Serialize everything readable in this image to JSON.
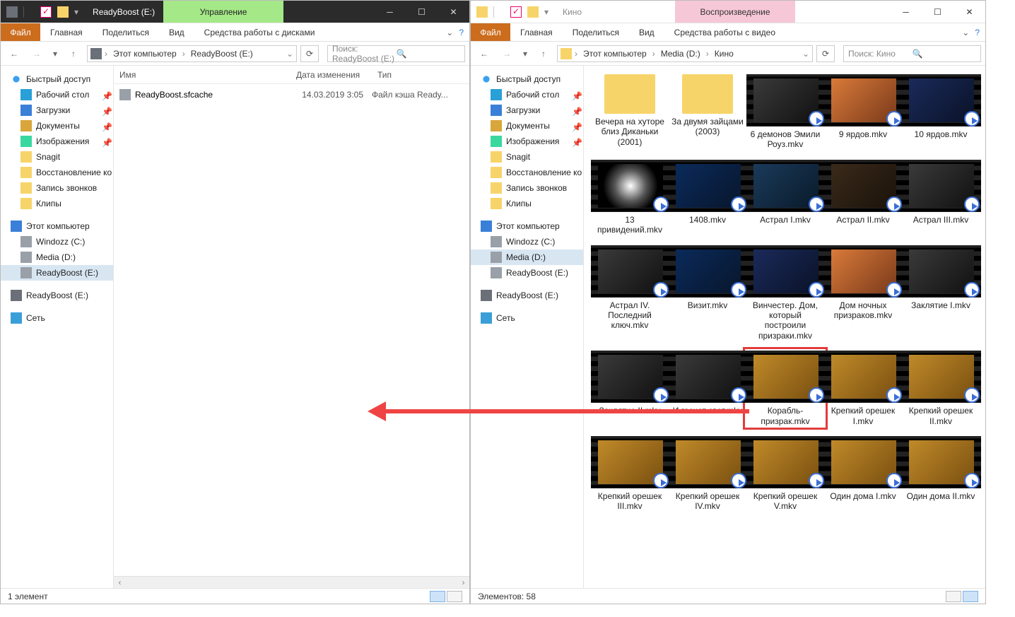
{
  "left": {
    "title": "ReadyBoost (E:)",
    "context_tab": "Управление",
    "file_menu": "Файл",
    "tabs": [
      "Главная",
      "Поделиться",
      "Вид"
    ],
    "context_ribbon": "Средства работы с дисками",
    "breadcrumbs": [
      "Этот компьютер",
      "ReadyBoost (E:)"
    ],
    "search_placeholder": "Поиск: ReadyBoost (E:)",
    "columns": {
      "name": "Имя",
      "date": "Дата изменения",
      "type": "Тип"
    },
    "file": {
      "name": "ReadyBoost.sfcache",
      "date": "14.03.2019 3:05",
      "type": "Файл кэша Ready..."
    },
    "status": "1 элемент"
  },
  "right": {
    "title": "Кино",
    "context_tab": "Воспроизведение",
    "file_menu": "Файл",
    "tabs": [
      "Главная",
      "Поделиться",
      "Вид"
    ],
    "context_ribbon": "Средства работы с видео",
    "breadcrumbs": [
      "Этот компьютер",
      "Media (D:)",
      "Кино"
    ],
    "search_placeholder": "Поиск: Кино",
    "status": "Элементов: 58",
    "items": [
      {
        "label": "Вечера на хуторе близ Диканьки (2001)",
        "folder": true
      },
      {
        "label": "За двумя зайцами (2003)",
        "folder": true
      },
      {
        "label": "6 демонов Эмили Роуз.mkv",
        "c": "c3"
      },
      {
        "label": "9 ярдов.mkv",
        "c": "c1"
      },
      {
        "label": "10 ярдов.mkv",
        "c": "c2"
      },
      {
        "label": "13 привидений.mkv",
        "c": "c4"
      },
      {
        "label": "1408.mkv",
        "c": "c5"
      },
      {
        "label": "Астрал I.mkv",
        "c": "c8"
      },
      {
        "label": "Астрал II.mkv",
        "c": "c6"
      },
      {
        "label": "Астрал III.mkv",
        "c": "c3"
      },
      {
        "label": "Астрал IV. Последний ключ.mkv",
        "c": "c3"
      },
      {
        "label": "Визит.mkv",
        "c": "c5"
      },
      {
        "label": "Винчестер. Дом, который построили призраки.mkv",
        "c": "c2"
      },
      {
        "label": "Дом ночных призраков.mkv",
        "c": "c1"
      },
      {
        "label": "Заклятие I.mkv",
        "c": "c3"
      },
      {
        "label": "Заклятие II.mkv",
        "c": "c3"
      },
      {
        "label": "И гаснет свет.mkv",
        "c": "c3"
      },
      {
        "label": "Корабль-призрак.mkv",
        "c": "c7",
        "sel": true
      },
      {
        "label": "Крепкий орешек I.mkv",
        "c": "c7"
      },
      {
        "label": "Крепкий орешек II.mkv",
        "c": "c7"
      },
      {
        "label": "Крепкий орешек III.mkv",
        "c": "c7"
      },
      {
        "label": "Крепкий орешек IV.mkv",
        "c": "c7"
      },
      {
        "label": "Крепкий орешек V.mkv",
        "c": "c7"
      },
      {
        "label": "Один дома I.mkv",
        "c": "c7"
      },
      {
        "label": "Один дома II.mkv",
        "c": "c7"
      }
    ]
  },
  "nav": {
    "quick": "Быстрый доступ",
    "desktop": "Рабочий стол",
    "downloads": "Загрузки",
    "documents": "Документы",
    "images": "Изображения",
    "snagit": "Snagit",
    "restore": "Восстановление ко",
    "calls": "Запись звонков",
    "clips": "Клипы",
    "thispc": "Этот компьютер",
    "windozz": "Windozz (C:)",
    "media": "Media (D:)",
    "readyboost": "ReadyBoost (E:)",
    "readyboost2": "ReadyBoost (E:)",
    "network": "Сеть"
  }
}
